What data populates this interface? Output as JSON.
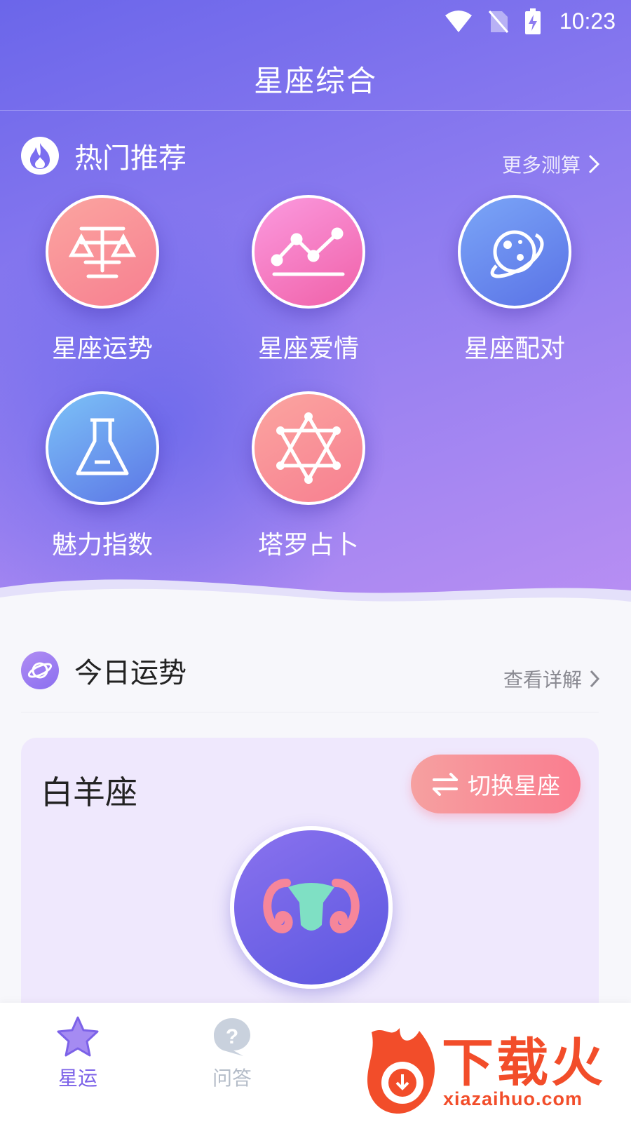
{
  "status_bar": {
    "time": "10:23"
  },
  "header": {
    "title": "星座综合"
  },
  "hot": {
    "title": "热门推荐",
    "more_label": "更多测算",
    "items": [
      {
        "label": "星座运势",
        "icon": "balance-scale-icon"
      },
      {
        "label": "星座爱情",
        "icon": "trend-line-icon"
      },
      {
        "label": "星座配对",
        "icon": "planet-icon"
      },
      {
        "label": "魅力指数",
        "icon": "flask-icon"
      },
      {
        "label": "塔罗占卜",
        "icon": "hexagram-icon"
      }
    ]
  },
  "today": {
    "title": "今日运势",
    "detail_label": "查看详解",
    "sign_name": "白羊座",
    "switch_label": "切换星座",
    "sign_icon": "aries-ram-icon"
  },
  "tabbar": {
    "tabs": [
      {
        "label": "星运",
        "icon": "star-icon",
        "active": true
      },
      {
        "label": "问答",
        "icon": "question-bubble-icon",
        "active": false
      }
    ]
  },
  "watermark": {
    "text": "下载火",
    "url": "xiazaihuo.com"
  },
  "colors": {
    "accent": "#8e7cf0",
    "active_tab": "#7c62e8",
    "inactive_tab": "#c2c9d6",
    "switch_button": "#fa7d8f"
  }
}
